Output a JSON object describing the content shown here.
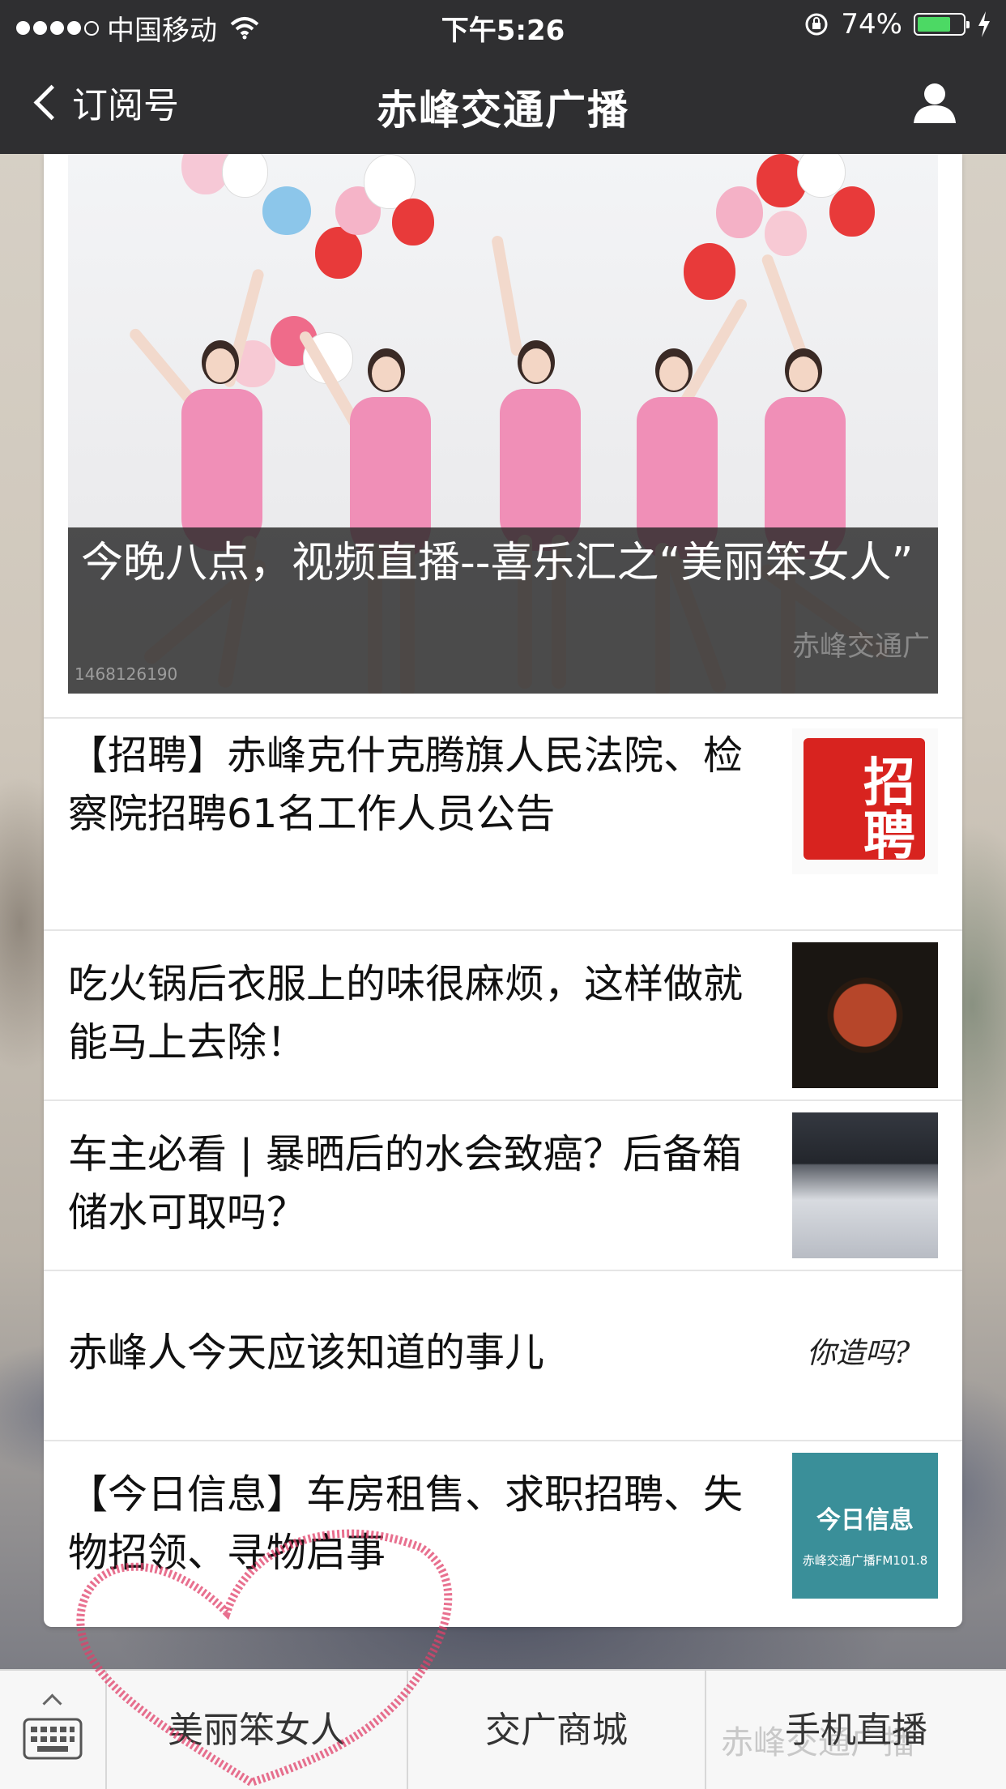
{
  "status_bar": {
    "carrier": "中国移动",
    "time": "下午5:26",
    "battery_percent_label": "74%",
    "battery_level": 0.74,
    "signal_bars_filled": 4,
    "signal_bars_total": 5
  },
  "nav": {
    "back_label": "订阅号",
    "title": "赤峰交通广播"
  },
  "hero": {
    "title": "今晚八点，视频直播--喜乐汇之“美丽笨女人”",
    "watermark": "赤峰交通广",
    "code": "1468126190"
  },
  "articles": [
    {
      "title": "【招聘】赤峰克什克腾旗人民法院、检察院招聘61名工作人员公告",
      "thumb_icon": "recruit-seal-image",
      "thumb_text_1": "招",
      "thumb_text_2": "聘"
    },
    {
      "title": "吃火锅后衣服上的味很麻烦，这样做就能马上去除！",
      "thumb_icon": "hotpot-image"
    },
    {
      "title": "车主必看 | 暴晒后的水会致癌？后备箱储水可取吗？",
      "thumb_icon": "car-trunk-image"
    },
    {
      "title": "赤峰人今天应该知道的事儿",
      "thumb_icon": "question-text-image",
      "thumb_text": "你造吗?"
    },
    {
      "title": "【今日信息】车房租售、求职招聘、失物招领、寻物启事",
      "thumb_icon": "daily-info-image",
      "thumb_text": "今日信息",
      "thumb_sub": "赤峰交通广播FM101.8"
    }
  ],
  "menu": {
    "tabs": [
      "美丽笨女人",
      "交广商城",
      "手机直播"
    ],
    "watermark": "赤峰交通广播"
  },
  "colors": {
    "bar_bg": "#2f2f31",
    "battery_green": "#4cd964",
    "recruit_red": "#d8231f",
    "daily_teal": "#3a8f99",
    "dress_pink": "#f08fb7"
  }
}
